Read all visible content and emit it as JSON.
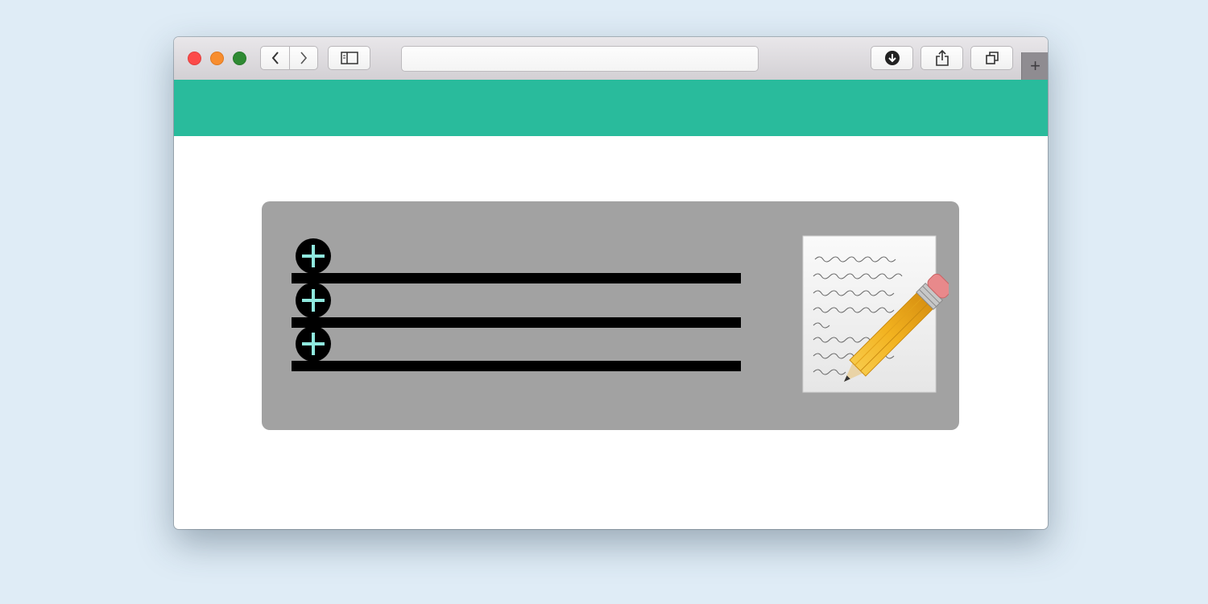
{
  "window": {
    "traffic_lights": {
      "close_color": "#fc4b4a",
      "minimize_color": "#f88d2e",
      "zoom_color": "#2f8a33"
    },
    "toolbar": {
      "back_icon": "chevron-left-icon",
      "forward_icon": "chevron-right-icon",
      "sidebar_icon": "sidebar-icon",
      "address_value": "",
      "downloads_icon": "download-icon",
      "share_icon": "share-icon",
      "tabs_icon": "tab-overview-icon",
      "new_tab_label": "+"
    }
  },
  "page": {
    "header_color": "#29bb9c",
    "card_color": "#a2a2a2",
    "rows": [
      {
        "add_icon": "plus-circle-icon"
      },
      {
        "add_icon": "plus-circle-icon"
      },
      {
        "add_icon": "plus-circle-icon"
      }
    ],
    "accent_color": "#8fe8de",
    "illustration": "textedit-pencil-icon"
  }
}
